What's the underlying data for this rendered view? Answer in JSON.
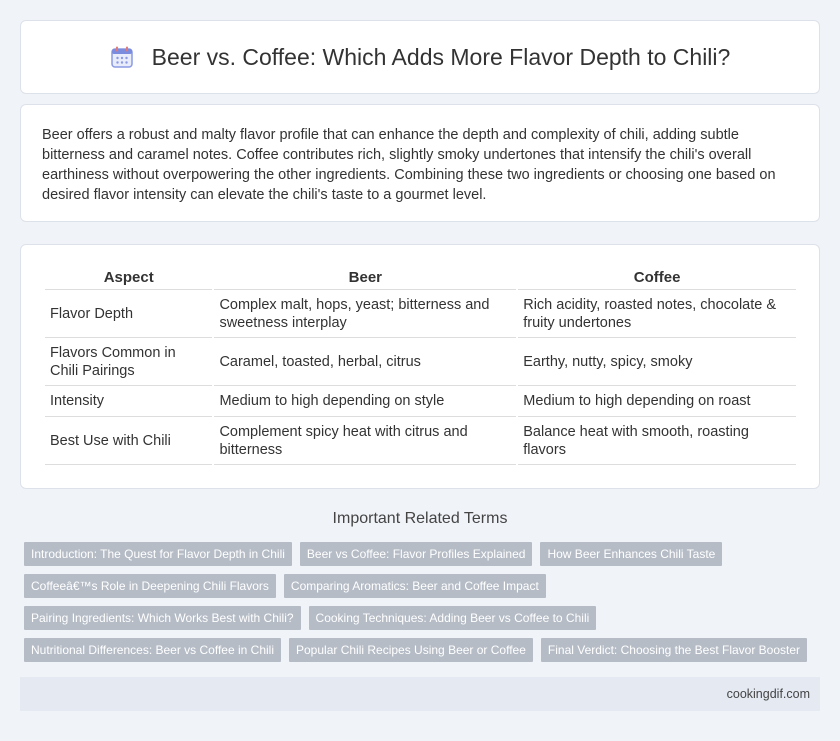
{
  "header": {
    "title": "Beer vs. Coffee: Which Adds More Flavor Depth to Chili?",
    "icon": "calendar-icon"
  },
  "intro": {
    "text": "Beer offers a robust and malty flavor profile that can enhance the depth and complexity of chili, adding subtle bitterness and caramel notes. Coffee contributes rich, slightly smoky undertones that intensify the chili's overall earthiness without overpowering the other ingredients. Combining these two ingredients or choosing one based on desired flavor intensity can elevate the chili's taste to a gourmet level."
  },
  "table": {
    "headers": [
      "Aspect",
      "Beer",
      "Coffee"
    ],
    "rows": [
      [
        "Flavor Depth",
        "Complex malt, hops, yeast; bitterness and sweetness interplay",
        "Rich acidity, roasted notes, chocolate & fruity undertones"
      ],
      [
        "Flavors Common in Chili Pairings",
        "Caramel, toasted, herbal, citrus",
        "Earthy, nutty, spicy, smoky"
      ],
      [
        "Intensity",
        "Medium to high depending on style",
        "Medium to high depending on roast"
      ],
      [
        "Best Use with Chili",
        "Complement spicy heat with citrus and bitterness",
        "Balance heat with smooth, roasting flavors"
      ]
    ]
  },
  "related": {
    "title": "Important Related Terms",
    "tags": [
      "Introduction: The Quest for Flavor Depth in Chili",
      "Beer vs Coffee: Flavor Profiles Explained",
      "How Beer Enhances Chili Taste",
      "Coffeeâ€™s Role in Deepening Chili Flavors",
      "Comparing Aromatics: Beer and Coffee Impact",
      "Pairing Ingredients: Which Works Best with Chili?",
      "Cooking Techniques: Adding Beer vs Coffee to Chili",
      "Nutritional Differences: Beer vs Coffee in Chili",
      "Popular Chili Recipes Using Beer or Coffee",
      "Final Verdict: Choosing the Best Flavor Booster"
    ]
  },
  "footer": {
    "site": "cookingdif.com"
  },
  "colors": {
    "background": "#f0f3f8",
    "tag": "#b5bcc6",
    "footer": "#e4e9f2",
    "icon_accent": "#7b8cde"
  }
}
